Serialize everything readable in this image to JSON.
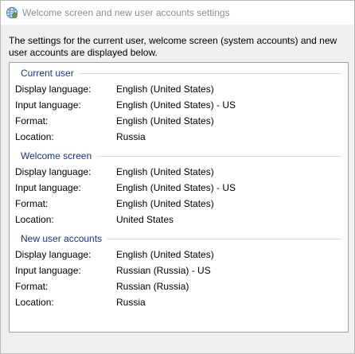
{
  "window": {
    "title": "Welcome screen and new user accounts settings",
    "icon": "globe-settings-icon"
  },
  "description": "The settings for the current user, welcome screen (system accounts) and new user accounts are displayed below.",
  "groups": [
    {
      "heading": "Current user",
      "rows": [
        {
          "label": "Display language:",
          "value": "English (United States)"
        },
        {
          "label": "Input language:",
          "value": "English (United States) - US"
        },
        {
          "label": "Format:",
          "value": "English (United States)"
        },
        {
          "label": "Location:",
          "value": "Russia"
        }
      ]
    },
    {
      "heading": "Welcome screen",
      "rows": [
        {
          "label": "Display language:",
          "value": "English (United States)"
        },
        {
          "label": "Input language:",
          "value": "English (United States) - US"
        },
        {
          "label": "Format:",
          "value": "English (United States)"
        },
        {
          "label": "Location:",
          "value": "United States"
        }
      ]
    },
    {
      "heading": "New user accounts",
      "rows": [
        {
          "label": "Display language:",
          "value": "English (United States)"
        },
        {
          "label": "Input language:",
          "value": "Russian (Russia) - US"
        },
        {
          "label": "Format:",
          "value": "Russian (Russia)"
        },
        {
          "label": "Location:",
          "value": "Russia"
        }
      ]
    }
  ],
  "colors": {
    "group_heading": "#1e3287",
    "title_text": "#8e8e8e",
    "dialog_background": "#f0f0f0"
  }
}
